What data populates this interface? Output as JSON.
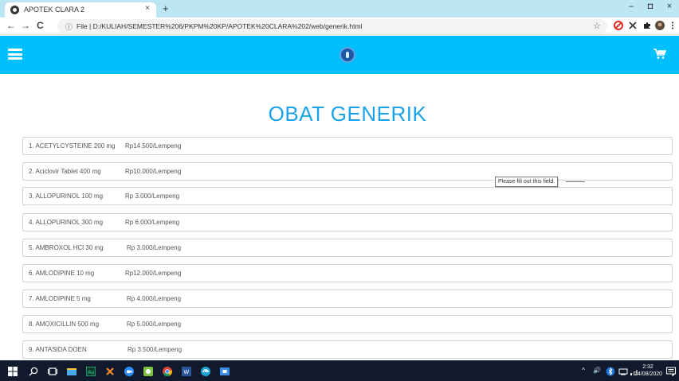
{
  "browser": {
    "tab_title": "APOTEK CLARA 2",
    "tab_close": "×",
    "new_tab": "+",
    "window_buttons": [
      "–",
      "◘",
      "×"
    ],
    "nav": {
      "back": "←",
      "forward": "→",
      "reload": "C"
    },
    "address_info": "ⓘ",
    "address_text": "File  |  D:/KULIAH/SEMESTER%206/PKPM%20KP/APOTEK%20CLARA%202/web/generik.html",
    "bookmark_star": "☆",
    "extensions": [
      "stop-extension-icon",
      "x-extension-icon",
      "puzzle-extension-icon",
      "profile-avatar-icon",
      "menu-kebab-icon"
    ]
  },
  "app": {
    "header_color": "#00bfff",
    "page_title": "OBAT GENERIK",
    "title_color": "#1aa3e8",
    "products": [
      {
        "name": "1. ACETYLCYSTEINE 200 mg",
        "price": "Rp14.500/Lempeng"
      },
      {
        "name": "2. Aciclovir Tablet 400 mg",
        "price": "Rp10.000/Lempeng"
      },
      {
        "name": "3. ALLOPURINOL 100 mg",
        "price": "Rp 3.000/Lempeng"
      },
      {
        "name": "4. ALLOPURINOL 300 mg",
        "price": "Rp 6.000/Lempeng"
      },
      {
        "name": "5. AMBROXOL HCl 30 mg",
        "price": "Rp 3.000/Lempeng"
      },
      {
        "name": "6. AMLODIPINE 10 mg",
        "price": "Rp12.000/Lempeng"
      },
      {
        "name": "7. AMLODIPINE 5 mg",
        "price": "Rp 4.000/Lempeng"
      },
      {
        "name": "8. AMOXICILLIN 500 mg",
        "price": "Rp 5.000/Lempeng"
      },
      {
        "name": "9. ANTASIDA DOEN",
        "price": "Rp 3.500/Lempeng"
      }
    ],
    "validation_tooltip": "Please fill out this field."
  },
  "taskbar": {
    "tray": {
      "chevron": "^",
      "volume": "🔊"
    },
    "time": "2:32",
    "date": "24/08/2020"
  }
}
